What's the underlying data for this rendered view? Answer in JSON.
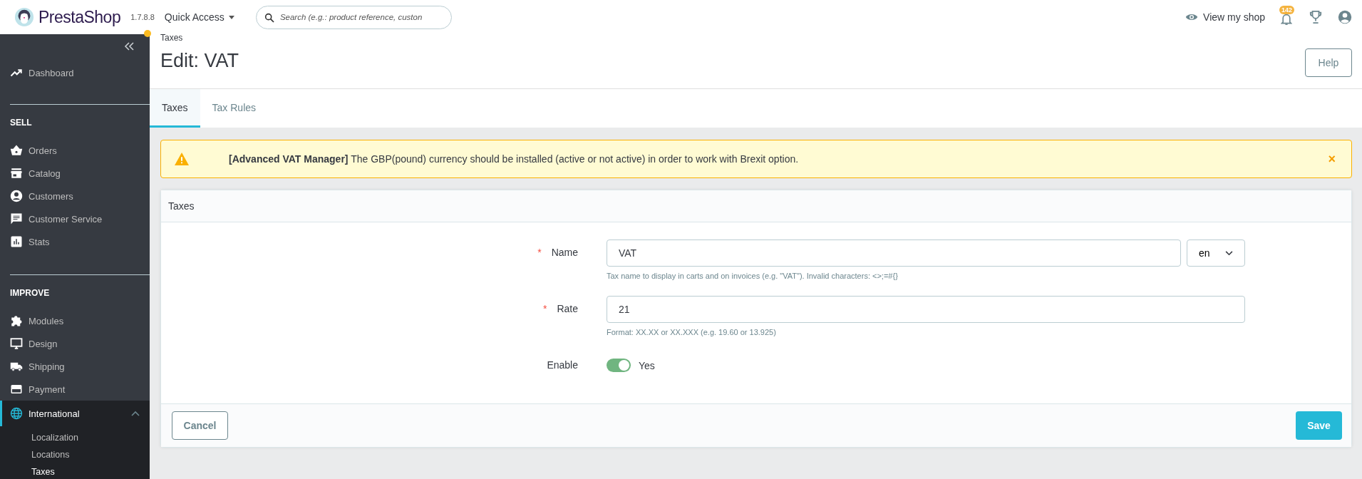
{
  "topbar": {
    "logo": "PrestaShop",
    "version": "1.7.8.8",
    "quick_access": "Quick Access",
    "search": {
      "placeholder": "Search (e.g.: product reference, custon"
    },
    "view_shop": "View my shop",
    "notifications": "142"
  },
  "sidebar": {
    "notice_dot": true,
    "items": [
      {
        "kind": "item",
        "label": "Dashboard",
        "selected": false
      },
      {
        "kind": "section",
        "label": "SELL"
      },
      {
        "kind": "item",
        "label": "Orders",
        "selected": false
      },
      {
        "kind": "item",
        "label": "Catalog",
        "selected": false
      },
      {
        "kind": "item",
        "label": "Customers",
        "selected": false
      },
      {
        "kind": "item",
        "label": "Customer Service",
        "selected": false
      },
      {
        "kind": "item",
        "label": "Stats",
        "selected": false
      },
      {
        "kind": "section",
        "label": "IMPROVE"
      },
      {
        "kind": "item",
        "label": "Modules",
        "selected": false
      },
      {
        "kind": "item",
        "label": "Design",
        "selected": false
      },
      {
        "kind": "item",
        "label": "Shipping",
        "selected": false
      },
      {
        "kind": "item",
        "label": "Payment",
        "selected": false
      },
      {
        "kind": "item",
        "label": "International",
        "selected": true,
        "expanded": true,
        "children": [
          {
            "label": "Localization",
            "selected": false
          },
          {
            "label": "Locations",
            "selected": false
          },
          {
            "label": "Taxes",
            "selected": true
          }
        ]
      }
    ]
  },
  "header": {
    "breadcrumb": "Taxes",
    "title": "Edit: VAT",
    "help": "Help"
  },
  "tabs": [
    {
      "label": "Taxes",
      "selected": true
    },
    {
      "label": "Tax Rules",
      "selected": false
    }
  ],
  "alert": {
    "text": "**[Advanced VAT Manager]** The GBP(pound) currency should be installed (active or not active) in order to work with Brexit option.",
    "close": "×"
  },
  "card": {
    "title": "Taxes",
    "required_mark": "*",
    "fields": [
      {
        "kind": "text",
        "label": "Name",
        "required": true,
        "value": "VAT",
        "language": "en",
        "help": "Tax name to display in carts and on invoices (e.g. \"VAT\"). Invalid characters: <>;=#{}"
      },
      {
        "kind": "text",
        "label": "Rate",
        "required": true,
        "value": "21",
        "help": "Format: XX.XX or XX.XXX (e.g. 19.60 or 13.925)"
      },
      {
        "kind": "switch",
        "label": "Enable",
        "required": false,
        "on": true,
        "state_label": "Yes"
      }
    ],
    "cancel": "Cancel",
    "save": "Save"
  }
}
